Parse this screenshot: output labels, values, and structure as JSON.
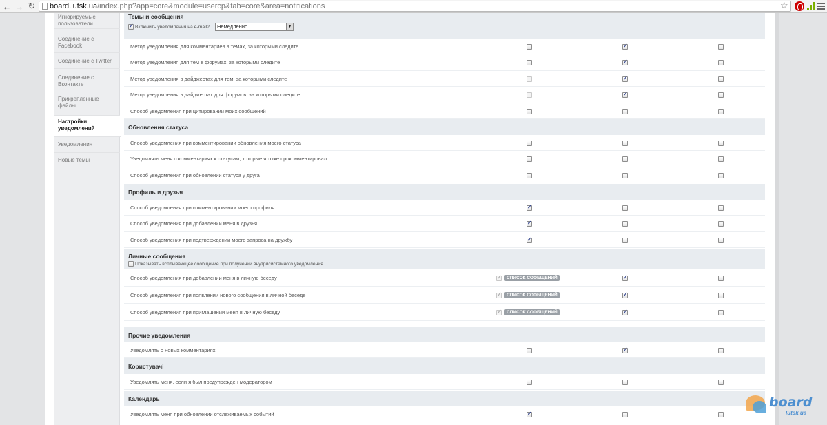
{
  "browser": {
    "host": "board.lutsk.ua",
    "path": "/index.php?app=core&module=usercp&tab=core&area=notifications"
  },
  "sidebar": {
    "items": [
      {
        "label": "Игнорируемые пользователи"
      },
      {
        "label": "Соединение с Facebook"
      },
      {
        "label": "Соединение с Twitter"
      },
      {
        "label": "Соединение с Вконтакте"
      },
      {
        "label": "Прикрепленные файлы"
      },
      {
        "label": "Настройки уведомлений"
      },
      {
        "label": "Уведомления"
      },
      {
        "label": "Новые темы"
      }
    ]
  },
  "sections": [
    {
      "title": "Темы и сообщения",
      "option": {
        "label": "Включить уведомления на e-mail?",
        "checked": true,
        "select_value": "Немедленно"
      },
      "rows": [
        {
          "label": "Метод уведомления для комментариев в темах, за которыми следите",
          "c1": false,
          "c2": true,
          "c3": false
        },
        {
          "label": "Метод уведомления для тем в форумах, за которыми следите",
          "c1": false,
          "c2": true,
          "c3": false
        },
        {
          "label": "Метод уведомления в дайджестах для тем, за которыми следите",
          "c1": false,
          "c1_disabled": true,
          "c2": true,
          "c3": false
        },
        {
          "label": "Метод уведомления в дайджестах для форумов, за которыми следите",
          "c1": false,
          "c1_disabled": true,
          "c2": true,
          "c3": false
        },
        {
          "label": "Способ уведомления при цитировании моих сообщений",
          "c1": false,
          "c2": false,
          "c3": false
        }
      ]
    },
    {
      "title": "Обновления статуса",
      "rows": [
        {
          "label": "Способ уведомления при комментировании обновления моего статуса",
          "c1": false,
          "c2": false,
          "c3": false
        },
        {
          "label": "Уведомлять меня о комментариях к статусам, которые я тоже прокомментировал",
          "c1": false,
          "c2": false,
          "c3": false
        },
        {
          "label": "Способ уведомления при обновлении статуса у друга",
          "c1": false,
          "c2": false,
          "c3": false
        }
      ]
    },
    {
      "title": "Профиль и друзья",
      "rows": [
        {
          "label": "Способ уведомления при комментировании моего профиля",
          "c1": true,
          "c2": false,
          "c3": false
        },
        {
          "label": "Способ уведомления при добавлении меня в друзья",
          "c1": true,
          "c2": false,
          "c3": false
        },
        {
          "label": "Способ уведомления при подтверждении моего запроса на дружбу",
          "c1": true,
          "c2": false,
          "c3": false
        }
      ]
    },
    {
      "title": "Личные сообщения",
      "option": {
        "label": "Показывать всплывающее сообщение при получении внутрисистемного уведомления",
        "checked": false
      },
      "rows": [
        {
          "label": "Способ уведомления при добавлении меня в личную беседу",
          "c1": true,
          "c1_disabled": true,
          "tag": "СПИСОК СООБЩЕНИЙ",
          "c2": true,
          "c3": false
        },
        {
          "label": "Способ уведомления при появлении нового сообщения в личной беседе",
          "c1": true,
          "c1_disabled": true,
          "tag": "СПИСОК СООБЩЕНИЙ",
          "c2": true,
          "c3": false
        },
        {
          "label": "Способ уведомления при приглашении меня в личную беседу",
          "c1": true,
          "c1_disabled": true,
          "tag": "СПИСОК СООБЩЕНИЙ",
          "c2": true,
          "c3": false
        }
      ]
    },
    {
      "title": "Прочие уведомления",
      "rows": [
        {
          "label": "Уведомлять о новых комментариях",
          "c1": false,
          "c2": true,
          "c3": false
        }
      ]
    },
    {
      "title": "Користувачі",
      "rows": [
        {
          "label": "Уведомлять меня, если я был предупрежден модератором",
          "c1": false,
          "c2": false,
          "c3": false
        }
      ]
    },
    {
      "title": "Календарь",
      "rows": [
        {
          "label": "Уведомлять меня при обновлении отслеживаемых событий",
          "c1": true,
          "c2": false,
          "c3": false
        }
      ]
    }
  ],
  "logo": {
    "word": "board",
    "sub": "lutsk.ua",
    "colors": {
      "orange": "#f2a64b",
      "blue": "#4d8fd0"
    }
  }
}
